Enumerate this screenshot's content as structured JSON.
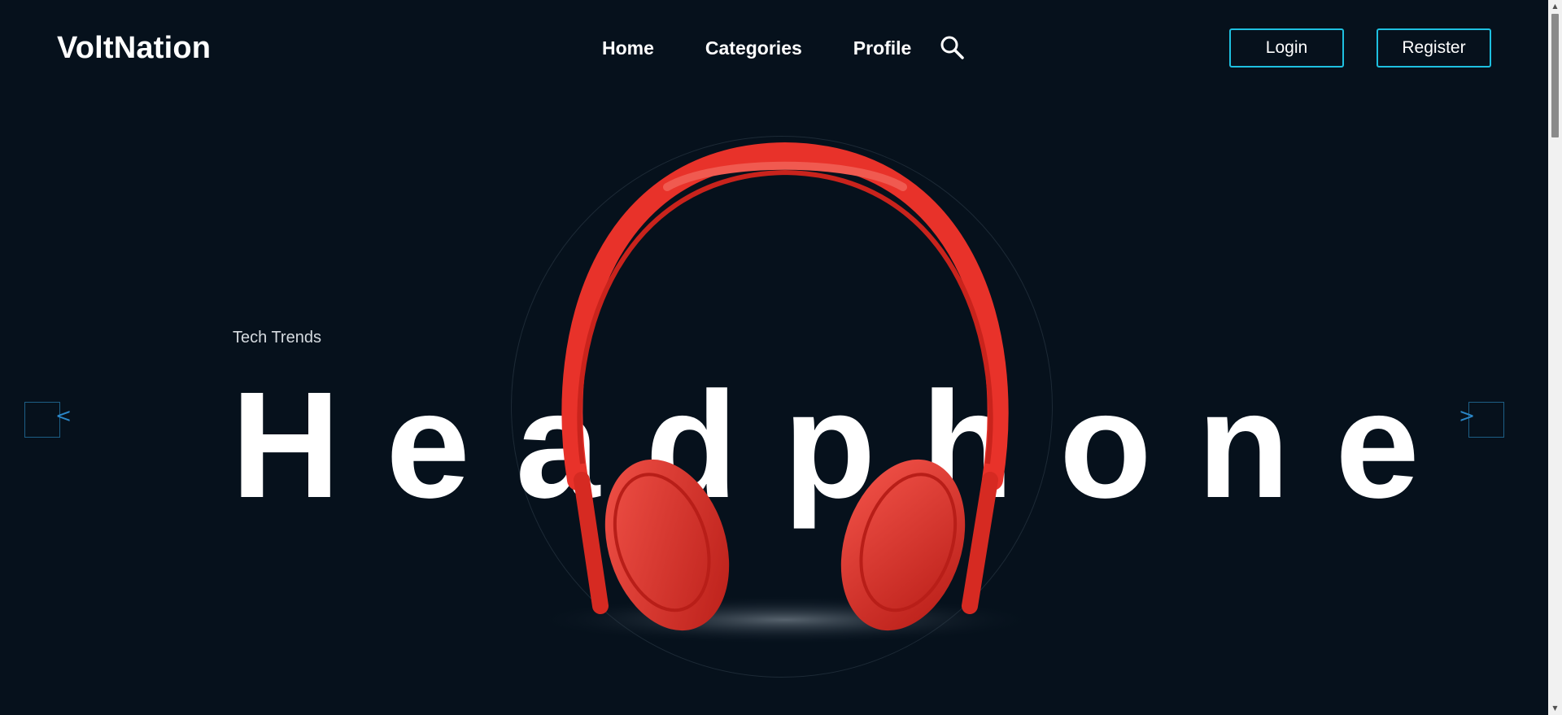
{
  "brand": {
    "name": "VoltNation"
  },
  "nav": {
    "items": [
      {
        "label": "Home"
      },
      {
        "label": "Categories"
      },
      {
        "label": "Profile"
      }
    ],
    "search_icon": "search-icon"
  },
  "auth": {
    "login_label": "Login",
    "register_label": "Register",
    "accent_color": "#1ec0e0"
  },
  "hero": {
    "tagline": "Tech Trends",
    "headline": "Headphone",
    "product_image": "red-headphones",
    "product_color": "#e8322a",
    "prev_arrow": "<",
    "next_arrow": ">"
  },
  "theme": {
    "background": "#06111c"
  }
}
